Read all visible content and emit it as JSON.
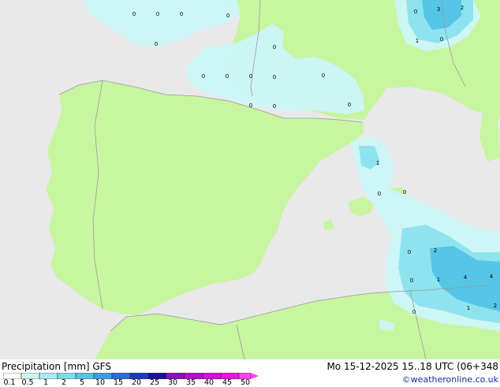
{
  "footer": {
    "legend_title": "Precipitation [mm]  GFS",
    "run_info": "Mo 15-12-2025 15..18 UTC (06+348",
    "credit": "©weatheronline.co.uk"
  },
  "legend": {
    "labels": [
      "0.1",
      "0.5",
      "1",
      "2",
      "5",
      "10",
      "15",
      "20",
      "25",
      "30",
      "35",
      "40",
      "45",
      "50"
    ],
    "colors": [
      "#ffffff",
      "#ccf5f5",
      "#a8ecf0",
      "#7fdbe9",
      "#55c3e6",
      "#3a9fe0",
      "#2a6fd1",
      "#1e3cb8",
      "#17129a",
      "#8a12b8",
      "#b010c8",
      "#d210d6",
      "#ea15d8",
      "#ff40f0"
    ]
  },
  "map": {
    "colors": {
      "sea": "#e9e9e9",
      "land": "#c8f5a0",
      "precip_light": "#cdf7f8",
      "precip_mid": "#8fe3ef",
      "precip_strong": "#55c6e6",
      "border": "#9a9a9a"
    },
    "value_labels": [
      "0",
      "0",
      "0",
      "0",
      "0",
      "0",
      "0",
      "0",
      "0",
      "0",
      "0",
      "0",
      "3",
      "2",
      "1",
      "0",
      "1",
      "0",
      "0",
      "0",
      "0",
      "0",
      "2",
      "0",
      "0",
      "1",
      "4",
      "4",
      "0",
      "1",
      "2"
    ]
  }
}
